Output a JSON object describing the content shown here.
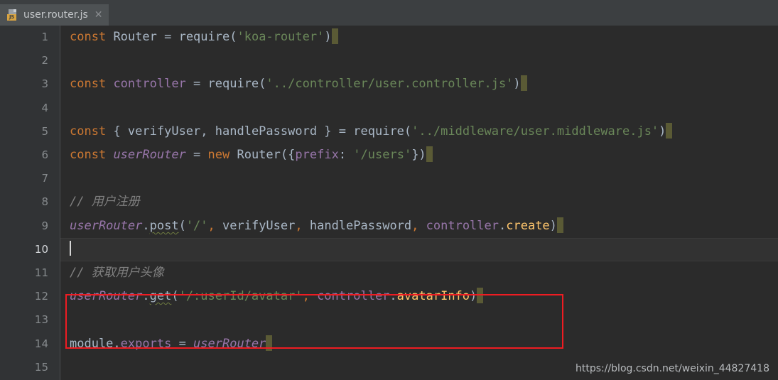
{
  "window": {
    "background": "#2b2b2b",
    "gutter_background": "#313335",
    "tabbar_background": "#3c3f41"
  },
  "tabbar": {
    "active_tab": {
      "label": "user.router.js",
      "icon": "js-file-icon",
      "badge_text": "JS",
      "close_glyph": "✕",
      "active_underline_color": "#4a88c7"
    }
  },
  "scrollbar": {
    "horizontal_top": "visible"
  },
  "editor": {
    "current_line": 10,
    "caret_line": 10,
    "line_numbers": [
      "1",
      "2",
      "3",
      "4",
      "5",
      "6",
      "7",
      "8",
      "9",
      "10",
      "11",
      "12",
      "13",
      "14",
      "15"
    ],
    "lines": [
      {
        "n": "1",
        "text": "const Router = require('koa-router')"
      },
      {
        "n": "2",
        "text": ""
      },
      {
        "n": "3",
        "text": "const controller = require('../controller/user.controller.js')"
      },
      {
        "n": "4",
        "text": ""
      },
      {
        "n": "5",
        "text": "const { verifyUser, handlePassword } = require('../middleware/user.middleware.js')"
      },
      {
        "n": "6",
        "text": "const userRouter = new Router({prefix: '/users'})"
      },
      {
        "n": "7",
        "text": ""
      },
      {
        "n": "8",
        "text": "// 用户注册"
      },
      {
        "n": "9",
        "text": "userRouter.post('/', verifyUser, handlePassword, controller.create)"
      },
      {
        "n": "10",
        "text": ""
      },
      {
        "n": "11",
        "text": "// 获取用户头像"
      },
      {
        "n": "12",
        "text": "userRouter.get('/:userId/avatar', controller.avatarInfo)"
      },
      {
        "n": "13",
        "text": ""
      },
      {
        "n": "14",
        "text": "module.exports = userRouter"
      },
      {
        "n": "15",
        "text": ""
      }
    ],
    "tokens": {
      "l1": {
        "kw": "const",
        "cls": "Router",
        "eq": " = ",
        "fn": "require",
        "open": "(",
        "str": "'koa-router'",
        "close": ")"
      },
      "l3": {
        "kw": "const",
        "var": "controller",
        "eq": " = ",
        "fn": "require",
        "open": "(",
        "str": "'../controller/user.controller.js'",
        "close": ")"
      },
      "l5": {
        "kw": "const",
        "brace_open": "{ ",
        "a": "verifyUser",
        "comma": ", ",
        "b": "handlePassword",
        "brace_close": " }",
        "eq": " = ",
        "fn": "require",
        "open": "(",
        "str": "'../middleware/user.middleware.js'",
        "close": ")"
      },
      "l6": {
        "kw": "const",
        "var": "userRouter",
        "eq": " = ",
        "kw2": "new",
        "cls": "Router",
        "open": "({",
        "prop": "prefix",
        "colon": ": ",
        "str": "'/users'",
        "close": "})"
      },
      "l8": {
        "comment": "// 用户注册"
      },
      "l9": {
        "obj": "userRouter",
        "dot": ".",
        "method": "post",
        "open": "(",
        "str": "'/'",
        "comma": ", ",
        "a": "verifyUser",
        "comma2": ", ",
        "b": "handlePassword",
        "comma3": ", ",
        "c": "controller",
        "dot2": ".",
        "d": "create",
        "close": ")"
      },
      "l11": {
        "comment": "// 获取用户头像"
      },
      "l12": {
        "obj": "userRouter",
        "dot": ".",
        "method": "get",
        "open": "(",
        "str": "'/:userId/avatar'",
        "comma": ", ",
        "c": "controller",
        "dot2": ".",
        "d": "avatarInfo",
        "close": ")"
      },
      "l14": {
        "obj": "module",
        "dot": ".",
        "prop": "exports",
        "eq": " = ",
        "var": "userRouter"
      }
    },
    "colors": {
      "keyword": "#cc7832",
      "string": "#6a8759",
      "function": "#ffc66d",
      "variable": "#9876aa",
      "identifier": "#a9b7c6",
      "comment": "#808080",
      "line_number": "#868a8d",
      "eol_marker": "#5a5a35",
      "error_squiggle": "#6d7a3f"
    }
  },
  "annotation": {
    "red_box_color": "#ee1c22",
    "highlights_lines": [
      "11",
      "12"
    ]
  },
  "watermark": {
    "text": "https://blog.csdn.net/weixin_44827418"
  }
}
